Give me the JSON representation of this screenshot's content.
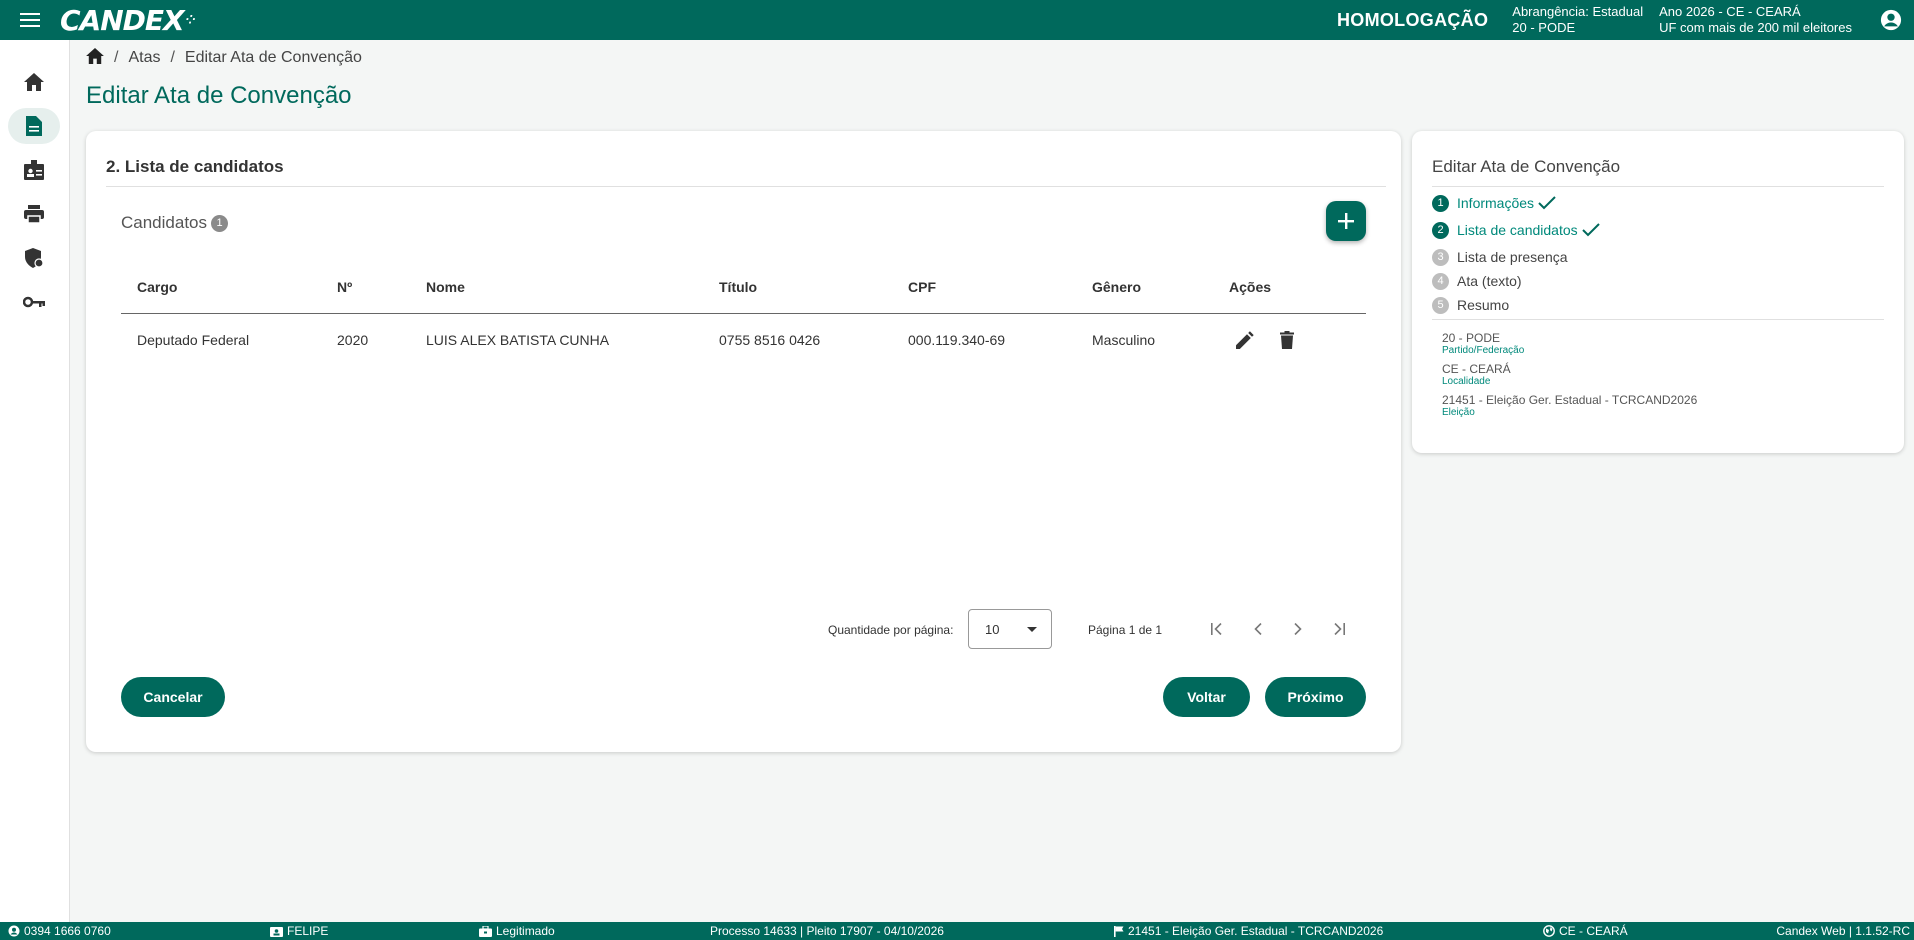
{
  "header": {
    "logo": "CANDEX",
    "environment": "HOMOLOGAÇÃO",
    "scope_line1": "Abrangência: Estadual",
    "scope_line2": "20 - PODE",
    "year_line1": "Ano 2026 - CE - CEARÁ",
    "year_line2": "UF com mais de 200 mil eleitores"
  },
  "sidebar": {
    "items": [
      {
        "icon": "home-icon"
      },
      {
        "icon": "document-icon"
      },
      {
        "icon": "badge-icon"
      },
      {
        "icon": "printer-icon"
      },
      {
        "icon": "shield-icon"
      },
      {
        "icon": "key-icon"
      }
    ]
  },
  "breadcrumb": {
    "items": [
      "Atas",
      "Editar Ata de Convenção"
    ]
  },
  "page": {
    "title": "Editar Ata de Convenção"
  },
  "main": {
    "section_title": "2. Lista de candidatos",
    "candidates_label": "Candidatos",
    "candidates_count": "1",
    "columns": [
      "Cargo",
      "Nº",
      "Nome",
      "Título",
      "CPF",
      "Gênero",
      "Ações"
    ],
    "rows": [
      {
        "cargo": "Deputado Federal",
        "numero": "2020",
        "nome": "LUIS ALEX BATISTA CUNHA",
        "titulo": "0755 8516 0426",
        "cpf": "000.119.340-69",
        "genero": "Masculino"
      }
    ],
    "paginator": {
      "page_size_label": "Quantidade por página:",
      "page_size": "10",
      "range": "Página 1 de 1"
    },
    "buttons": {
      "cancel": "Cancelar",
      "back": "Voltar",
      "next": "Próximo"
    }
  },
  "side": {
    "title": "Editar Ata de Convenção",
    "steps": [
      {
        "num": "1",
        "label": "Informações",
        "done": true
      },
      {
        "num": "2",
        "label": "Lista de candidatos",
        "done": true
      },
      {
        "num": "3",
        "label": "Lista de presença",
        "done": false
      },
      {
        "num": "4",
        "label": "Ata (texto)",
        "done": false
      },
      {
        "num": "5",
        "label": "Resumo",
        "done": false
      }
    ],
    "meta": [
      {
        "value": "20 - PODE",
        "label": "Partido/Federação"
      },
      {
        "value": "CE - CEARÁ",
        "label": "Localidade"
      },
      {
        "value": "21451 - Eleição Ger. Estadual - TCRCAND2026",
        "label": "Eleição"
      }
    ]
  },
  "footer": {
    "phone": "0394 1666 0760",
    "user": "FELIPE",
    "status": "Legitimado",
    "process": "Processo 14633 | Pleito 17907 - 04/10/2026",
    "election": "21451 - Eleição Ger. Estadual - TCRCAND2026",
    "locality": "CE - CEARÁ",
    "version": "Candex Web | 1.1.52-RC"
  },
  "colors": {
    "primary": "#00695c",
    "accent": "#00897b"
  }
}
